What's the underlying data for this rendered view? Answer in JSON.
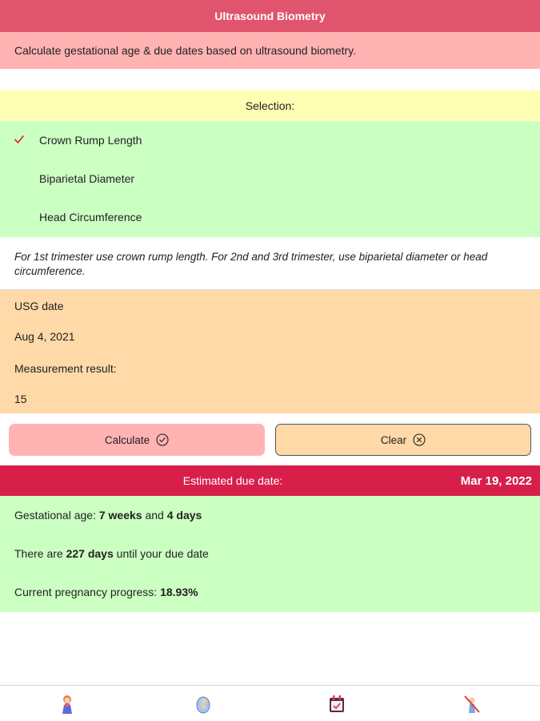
{
  "title": "Ultrasound Biometry",
  "subtitle": "Calculate gestational age & due dates based on ultrasound biometry.",
  "selection": {
    "header": "Selection:",
    "items": [
      {
        "label": "Crown Rump Length",
        "selected": true
      },
      {
        "label": "Biparietal Diameter",
        "selected": false
      },
      {
        "label": "Head Circumference",
        "selected": false
      }
    ]
  },
  "note": "For 1st trimester use crown rump length. For 2nd and 3rd trimester, use biparietal diameter or head circumference.",
  "inputs": {
    "usg_date_label": "USG date",
    "usg_date_value": "Aug 4, 2021",
    "measurement_label": "Measurement result:",
    "measurement_value": "15"
  },
  "buttons": {
    "calculate": "Calculate",
    "clear": "Clear"
  },
  "due": {
    "label": "Estimated due date:",
    "value": "Mar 19, 2022"
  },
  "results": {
    "ga_prefix": "Gestational age: ",
    "ga_weeks": "7 weeks",
    "ga_and": " and ",
    "ga_days": "4 days",
    "days_prefix": "There are ",
    "days_value": "227 days",
    "days_suffix": " until your due date",
    "progress_prefix": "Current pregnancy progress: ",
    "progress_value": "18.93%"
  },
  "tabs": [
    {
      "icon": "woman-icon"
    },
    {
      "icon": "fetus-icon"
    },
    {
      "icon": "calendar-icon"
    },
    {
      "icon": "no-pregnancy-icon"
    }
  ],
  "colors": {
    "title_bar": "#e0556d",
    "subtitle_bg": "#ffb3b3",
    "selection_header_bg": "#ffffb3",
    "selection_bg": "#ccffc2",
    "inputs_bg": "#ffd9a8",
    "due_bar": "#d81f4a",
    "results_bg": "#ccffc2",
    "check": "#d81f4a"
  }
}
